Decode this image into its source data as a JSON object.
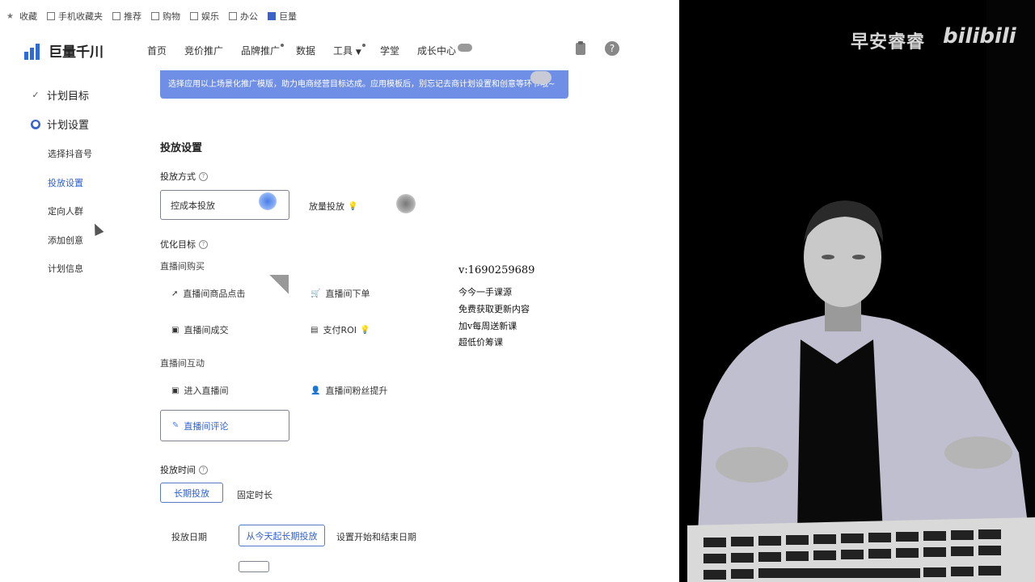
{
  "bookmarks": [
    {
      "icon": "star-icon",
      "label": "收藏"
    },
    {
      "icon": "phone-icon",
      "label": "手机收藏夹"
    },
    {
      "icon": "grid-icon",
      "label": "推荐"
    },
    {
      "icon": "grid-icon",
      "label": "购物"
    },
    {
      "icon": "grid-icon",
      "label": "娱乐"
    },
    {
      "icon": "grid-icon",
      "label": "办公"
    },
    {
      "icon": "tab-icon",
      "label": "巨量"
    }
  ],
  "header": {
    "logo_text": "巨量千川",
    "nav": [
      "首页",
      "竞价推广",
      "品牌推广",
      "数据",
      "工具",
      "学堂",
      "成长中心"
    ]
  },
  "sidebar": {
    "steps": [
      {
        "label": "计划目标",
        "status": "done"
      },
      {
        "label": "计划设置",
        "status": "active"
      }
    ],
    "items": [
      {
        "label": "选择抖音号"
      },
      {
        "label": "投放设置"
      },
      {
        "label": "定向人群"
      },
      {
        "label": "添加创意"
      },
      {
        "label": "计划信息"
      }
    ]
  },
  "banner": {
    "text": "选择应用以上场景化推广模版，助力电商经营目标达成。应用模板后，别忘记去商计划设置和创意等环节哦~"
  },
  "settings": {
    "title": "投放设置",
    "delivery_method": {
      "label": "投放方式",
      "options": [
        "控成本投放",
        "放量投放"
      ],
      "selected": "控成本投放"
    },
    "optimization": {
      "label": "优化目标",
      "group1": "直播间购买",
      "group1_options": [
        "直播间商品点击",
        "直播间下单",
        "直播间成交",
        "支付ROI"
      ],
      "group2": "直播间互动",
      "group2_options": [
        "进入直播间",
        "直播间粉丝提升",
        "直播间评论"
      ],
      "selected": "直播间评论"
    },
    "time": {
      "label": "投放时间",
      "options": [
        "长期投放",
        "固定时长"
      ],
      "selected": "长期投放",
      "date_label": "投放日期",
      "date_options": [
        "从今天起长期投放",
        "设置开始和结束日期"
      ]
    }
  },
  "overlay": {
    "lines": [
      "v:1690259689",
      "今今一手课源",
      "免费获取更新内容",
      "加v每周送新课",
      "超低价筹课"
    ]
  },
  "video": {
    "watermark": "早安睿睿",
    "brand": "bilibili"
  }
}
